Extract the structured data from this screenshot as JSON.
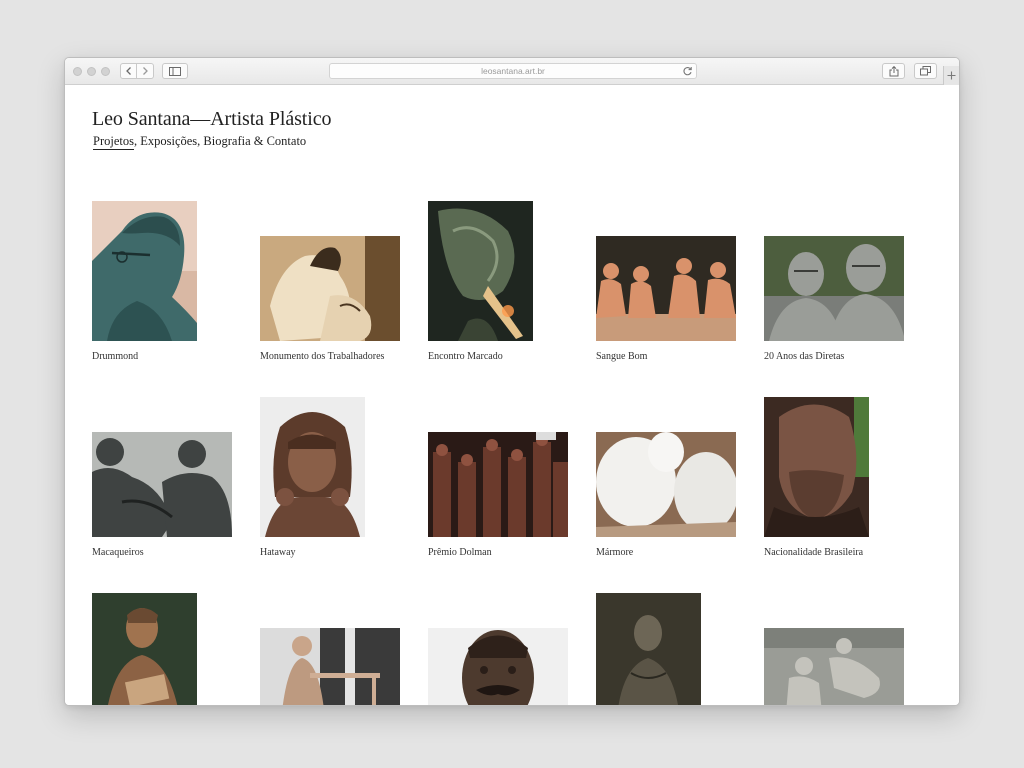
{
  "browser": {
    "url": "leosantana.art.br"
  },
  "site": {
    "title": "Leo Santana—Artista Plástico",
    "nav": {
      "active": "Projetos",
      "rest": ", Exposições, Biografia & Contato"
    }
  },
  "projects": [
    {
      "caption": "Drummond",
      "icon": "bust-with-glasses"
    },
    {
      "caption": "Monumento dos Trabalhadores",
      "icon": "workers-sculpture"
    },
    {
      "caption": "Encontro Marcado",
      "icon": "welding-bronze"
    },
    {
      "caption": "Sangue Bom",
      "icon": "seated-figures-row"
    },
    {
      "caption": "20 Anos das Diretas",
      "icon": "two-busts"
    },
    {
      "caption": "Macaqueiros",
      "icon": "crouching-figures"
    },
    {
      "caption": "Hataway",
      "icon": "bronze-head-with-bangs"
    },
    {
      "caption": "Prêmio Dolman",
      "icon": "trophy-figures"
    },
    {
      "caption": "Mármore",
      "icon": "white-marble-forms"
    },
    {
      "caption": "Nacionalidade Brasileira",
      "icon": "bearded-bust"
    },
    {
      "caption": "",
      "icon": "seated-woman-statue"
    },
    {
      "caption": "",
      "icon": "figure-at-table"
    },
    {
      "caption": "",
      "icon": "mustached-bust"
    },
    {
      "caption": "",
      "icon": "standing-figure-dark"
    },
    {
      "caption": "",
      "icon": "reclining-figures"
    }
  ]
}
